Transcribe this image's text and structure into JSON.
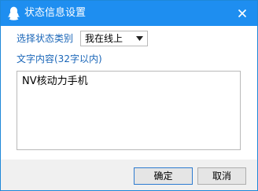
{
  "window": {
    "title": "状态信息设置",
    "icon": "qq-penguin-icon",
    "accent_color": "#1e8ef0"
  },
  "form": {
    "category_label": "选择状态类别",
    "category_value": "我在线上",
    "content_label": "文字内容(32字以内)",
    "content_value": "NV核动力手机"
  },
  "buttons": {
    "ok_label": "确定",
    "cancel_label": "取消"
  }
}
